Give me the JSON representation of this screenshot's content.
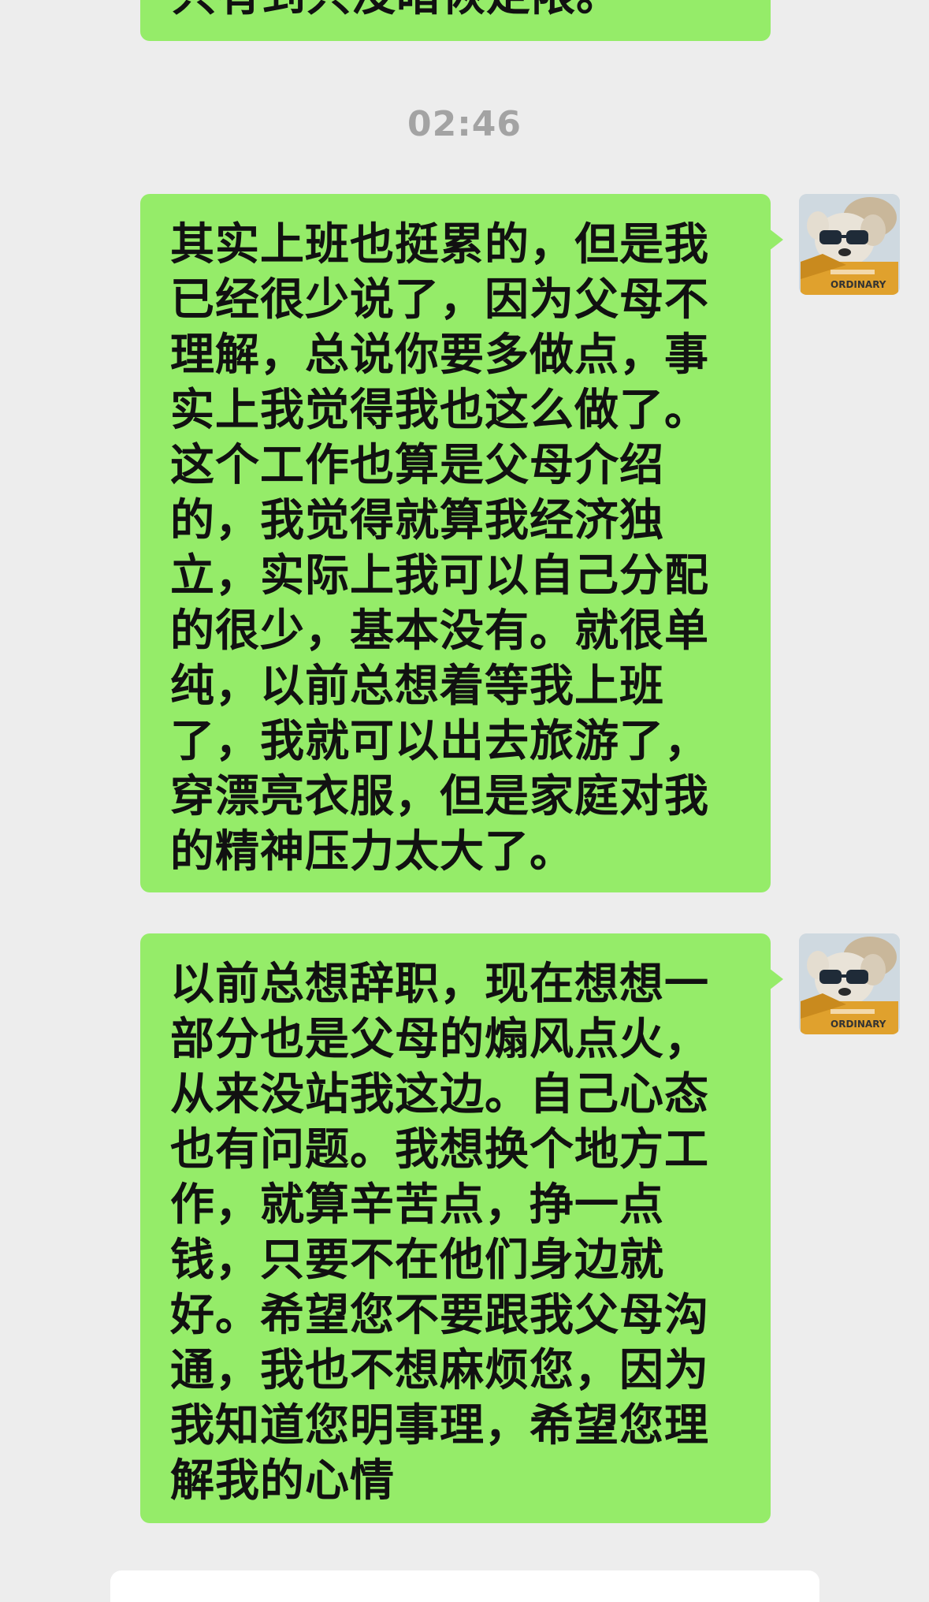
{
  "conversation": {
    "previous_message_fragment": "只有到只没暗恢定限。",
    "timestamp": "02:46",
    "messages": [
      {
        "sender": "self",
        "text": "其实上班也挺累的，但是我已经很少说了，因为父母不理解，总说你要多做点，事实上我觉得我也这么做了。这个工作也算是父母介绍的，我觉得就算我经济独立，实际上我可以自己分配的很少，基本没有。就很单纯，以前总想着等我上班了，我就可以出去旅游了，穿漂亮衣服，但是家庭对我的精神压力太大了。"
      },
      {
        "sender": "self",
        "text": "以前总想辞职，现在想想一部分也是父母的煽风点火，从来没站我这边。自己心态也有问题。我想换个地方工作，就算辛苦点，挣一点钱，只要不在他们身边就好。希望您不要跟我父母沟通，我也不想麻烦您，因为我知道您明事理，希望您理解我的心情"
      }
    ]
  },
  "avatar": {
    "label": "ORDINARY",
    "icon": "bear-with-sunglasses-avatar"
  },
  "colors": {
    "background": "#ededed",
    "bubble": "#95ec69",
    "timestamp": "#a3a3a3"
  }
}
